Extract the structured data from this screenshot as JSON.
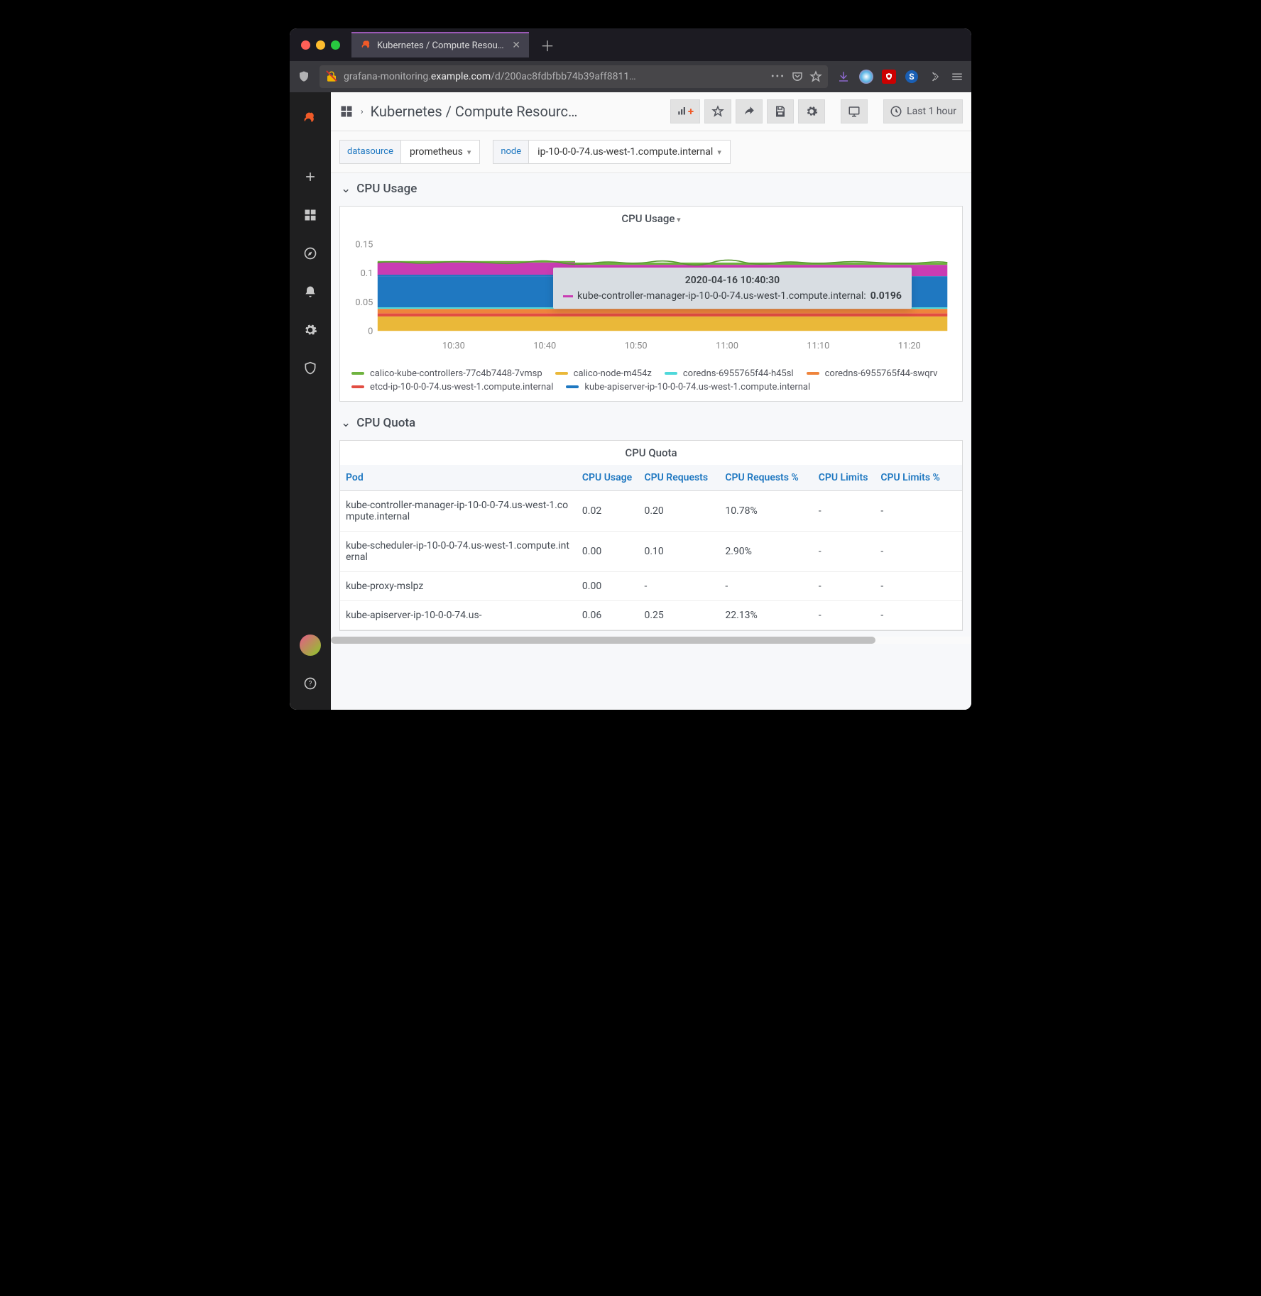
{
  "browser": {
    "tab_title": "Kubernetes / Compute Resourc…",
    "url_prefix": "grafana-monitoring.",
    "url_host": "example.com",
    "url_path": "/d/200ac8fdbfbb74b39aff8811…"
  },
  "dashboard": {
    "title": "Kubernetes / Compute Resourc…",
    "timerange": "Last 1 hour"
  },
  "vars": [
    {
      "label": "datasource",
      "value": "prometheus"
    },
    {
      "label": "node",
      "value": "ip-10-0-0-74.us-west-1.compute.internal"
    }
  ],
  "rows": {
    "cpu_usage": "CPU Usage",
    "cpu_quota": "CPU Quota"
  },
  "panel_titles": {
    "cpu_usage": "CPU Usage",
    "cpu_quota": "CPU Quota"
  },
  "tooltip": {
    "timestamp": "2020-04-16 10:40:30",
    "series": "kube-controller-manager-ip-10-0-0-74.us-west-1.compute.internal:",
    "value": "0.0196",
    "color": "#c93cb3"
  },
  "legend": [
    {
      "name": "calico-kube-controllers-77c4b7448-7vmsp",
      "color": "#6fb33f"
    },
    {
      "name": "calico-node-m454z",
      "color": "#eab839"
    },
    {
      "name": "coredns-6955765f44-h45sl",
      "color": "#4ed8da"
    },
    {
      "name": "coredns-6955765f44-swqrv",
      "color": "#ef843c"
    },
    {
      "name": "etcd-ip-10-0-0-74.us-west-1.compute.internal",
      "color": "#e24d42"
    },
    {
      "name": "kube-apiserver-ip-10-0-0-74.us-west-1.compute.internal",
      "color": "#1f78c1"
    }
  ],
  "table": {
    "headers": [
      "Pod",
      "CPU Usage",
      "CPU Requests",
      "CPU Requests %",
      "CPU Limits",
      "CPU Limits %"
    ],
    "rows": [
      {
        "pod": "kube-controller-manager-ip-10-0-0-74.us-west-1.compute.internal",
        "usage": "0.02",
        "req": "0.20",
        "reqp": "10.78%",
        "lim": "-",
        "limp": "-"
      },
      {
        "pod": "kube-scheduler-ip-10-0-0-74.us-west-1.compute.internal",
        "usage": "0.00",
        "req": "0.10",
        "reqp": "2.90%",
        "lim": "-",
        "limp": "-"
      },
      {
        "pod": "kube-proxy-mslpz",
        "usage": "0.00",
        "req": "-",
        "reqp": "-",
        "lim": "-",
        "limp": "-"
      },
      {
        "pod": "kube-apiserver-ip-10-0-0-74.us-",
        "usage": "0.06",
        "req": "0.25",
        "reqp": "22.13%",
        "lim": "-",
        "limp": "-"
      }
    ]
  },
  "chart_data": {
    "type": "area",
    "title": "CPU Usage",
    "xlabel": "",
    "ylabel": "",
    "ylim": [
      0,
      0.15
    ],
    "x_ticks": [
      "10:30",
      "10:40",
      "10:50",
      "11:00",
      "11:10",
      "11:20"
    ],
    "y_ticks": [
      0,
      0.05,
      0.1,
      0.15
    ],
    "stacked": true,
    "series": [
      {
        "name": "calico-node-m454z",
        "color": "#eab839",
        "approx_value": 0.025
      },
      {
        "name": "etcd-ip-10-0-0-74.us-west-1.compute.internal",
        "color": "#e24d42",
        "approx_value": 0.005
      },
      {
        "name": "coredns-6955765f44-swqrv",
        "color": "#ef843c",
        "approx_value": 0.008
      },
      {
        "name": "coredns-6955765f44-h45sl",
        "color": "#4ed8da",
        "approx_value": 0.002
      },
      {
        "name": "kube-apiserver-ip-10-0-0-74.us-west-1.compute.internal",
        "color": "#1f78c1",
        "approx_value": 0.055
      },
      {
        "name": "kube-controller-manager-ip-10-0-0-74.us-west-1.compute.internal",
        "color": "#c93cb3",
        "approx_value": 0.02
      },
      {
        "name": "calico-kube-controllers-77c4b7448-7vmsp",
        "color": "#6fb33f",
        "approx_value": 0.003
      }
    ],
    "total_approx": 0.118
  }
}
